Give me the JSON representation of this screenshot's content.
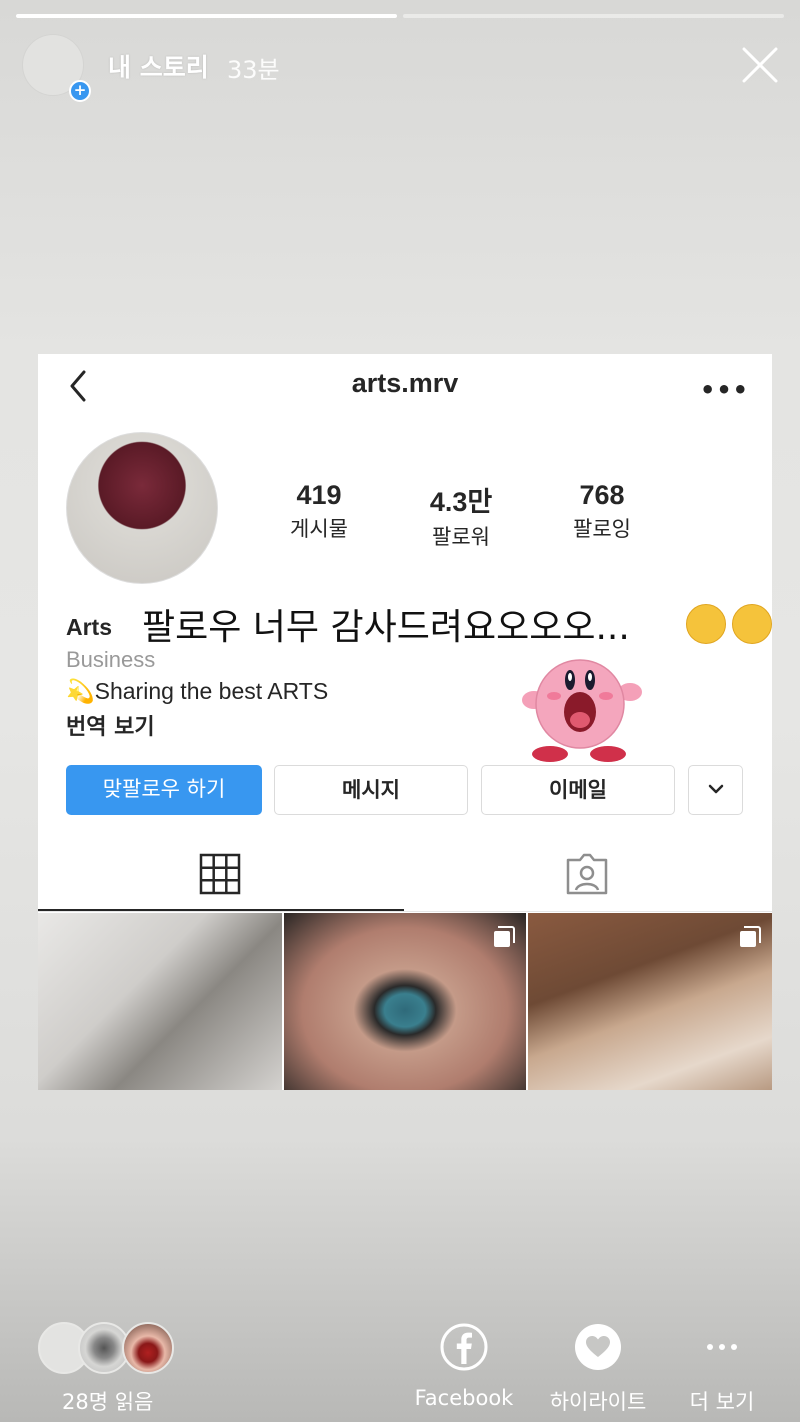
{
  "story": {
    "progress": [
      1.0,
      0.0
    ],
    "title": "내 스토리",
    "time": "33분"
  },
  "profile_screenshot": {
    "username": "arts.mrv",
    "stats": [
      {
        "num": "419",
        "label": "게시물"
      },
      {
        "num": "4.3만",
        "label": "팔로워"
      },
      {
        "num": "768",
        "label": "팔로잉"
      }
    ],
    "name": "Arts",
    "overlay_text": "팔로우 너무 감사드려요오오오...",
    "category": "Business",
    "bio": "💫Sharing the best ARTS",
    "translate": "번역 보기",
    "buttons": {
      "follow_back": "맞팔로우 하기",
      "message": "메시지",
      "email": "이메일"
    }
  },
  "footer": {
    "seen": "28명 읽음",
    "actions": {
      "facebook": "Facebook",
      "highlight": "하이라이트",
      "more": "더 보기"
    }
  },
  "colors": {
    "accent": "#3897f0",
    "text": "#262626"
  }
}
